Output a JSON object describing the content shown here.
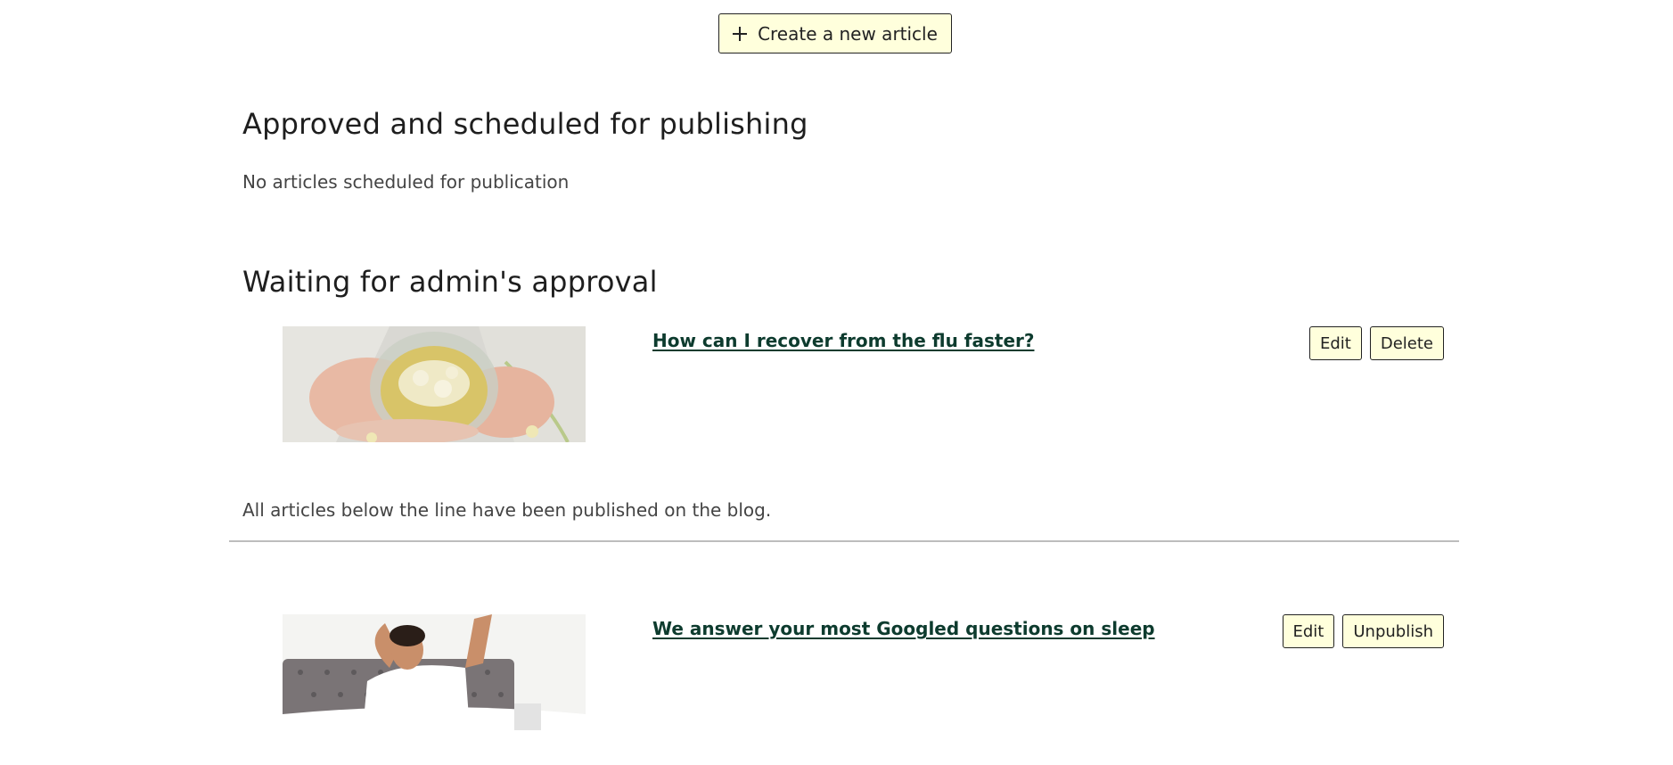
{
  "toolbar": {
    "create_label": "Create a new article"
  },
  "scheduled": {
    "heading": "Approved and scheduled for publishing",
    "empty_text": "No articles scheduled for publication"
  },
  "pending": {
    "heading": "Waiting for admin's approval",
    "articles": [
      {
        "title": "How can I recover from the flu faster?",
        "image": "cup-of-herbal-tea-in-hands",
        "actions": [
          "Edit",
          "Delete"
        ]
      }
    ]
  },
  "published": {
    "note": "All articles below the line have been published on the blog.",
    "articles": [
      {
        "title": "We answer your most Googled questions on sleep",
        "image": "man-stretching-in-bed",
        "actions": [
          "Edit",
          "Unpublish"
        ]
      }
    ]
  },
  "colors": {
    "button_bg": "#ffffdc",
    "link": "#0d3b2e",
    "divider": "#bdbdbd"
  }
}
